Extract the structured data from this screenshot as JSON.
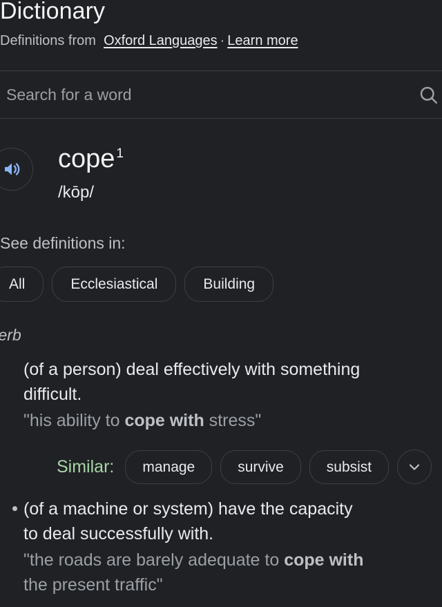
{
  "panel": {
    "title": "Dictionary",
    "source_prefix": "Definitions from",
    "source_link": "Oxford Languages",
    "separator": "·",
    "learn_more": "Learn more"
  },
  "search": {
    "placeholder": "Search for a word",
    "value": "",
    "icon": "search-icon"
  },
  "entry": {
    "audio_icon": "speaker-icon",
    "headword": "cope",
    "homograph_number": "1",
    "phonetic": "/kōp/"
  },
  "filters": {
    "label": "See definitions in:",
    "chips": [
      {
        "label": "All"
      },
      {
        "label": "Ecclesiastical"
      },
      {
        "label": "Building"
      }
    ]
  },
  "senses": [
    {
      "part_of_speech": "verb",
      "definitions": [
        {
          "bulleted": false,
          "text_line1": "(of a person) deal effectively with something",
          "text_line2": "difficult.",
          "quote_line1_pre": "\"his ability to ",
          "quote_line1_bold": "cope with",
          "quote_line1_post": " stress\"",
          "quote_line2": "",
          "similar": {
            "label": "Similar:",
            "chips": [
              {
                "label": "manage"
              },
              {
                "label": "survive"
              },
              {
                "label": "subsist"
              }
            ],
            "expand_icon": "chevron-down-icon"
          }
        },
        {
          "bulleted": true,
          "text_line1": "(of a machine or system) have the capacity",
          "text_line2": "to deal successfully with.",
          "quote_line1_pre": "\"the roads are barely adequate to ",
          "quote_line1_bold": "cope with",
          "quote_line1_post": "",
          "quote_line2": "the present traffic\"",
          "similar": null
        }
      ]
    }
  ],
  "colors": {
    "background": "#202124",
    "text_primary": "#e8eaed",
    "text_secondary": "#9aa0a6",
    "accent_blue": "#8ab4f8",
    "similar_green": "#a5d6a7",
    "border": "#3c4043"
  }
}
